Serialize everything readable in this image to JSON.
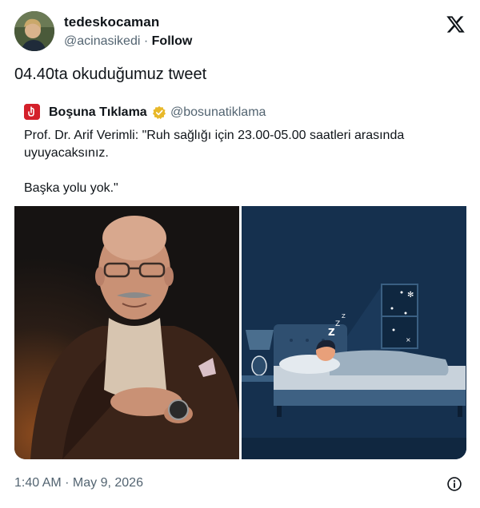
{
  "author": {
    "display_name": "tedeskocaman",
    "handle": "@acinasikedi",
    "separator": "·",
    "follow_label": "Follow"
  },
  "tweet": {
    "text": "04.40ta okuduğumuz tweet",
    "timestamp": "1:40 AM · May 9, 2026"
  },
  "quoted": {
    "display_name": "Boşuna Tıklama",
    "handle": "@bosunatiklama",
    "verified": true,
    "text": "Prof. Dr. Arif Verimli: \"Ruh sağlığı için 23.00-05.00 saatleri arasında uyuyacaksınız.\n\nBaşka yolu yok.\"",
    "verified_color": "#e8b829",
    "avatar_color": "#d4202a"
  },
  "icons": {
    "platform_logo": "x-logo-icon",
    "info": "info-icon",
    "verified": "verified-badge-icon"
  },
  "media": {
    "images": [
      {
        "name": "portrait-photo",
        "description_icon": "photo"
      },
      {
        "name": "sleep-illustration",
        "description_icon": "illustration"
      }
    ],
    "sleep_glyph": "Z"
  },
  "colors": {
    "text_primary": "#0f1419",
    "text_secondary": "#536471",
    "night_bg": "#15304e"
  }
}
